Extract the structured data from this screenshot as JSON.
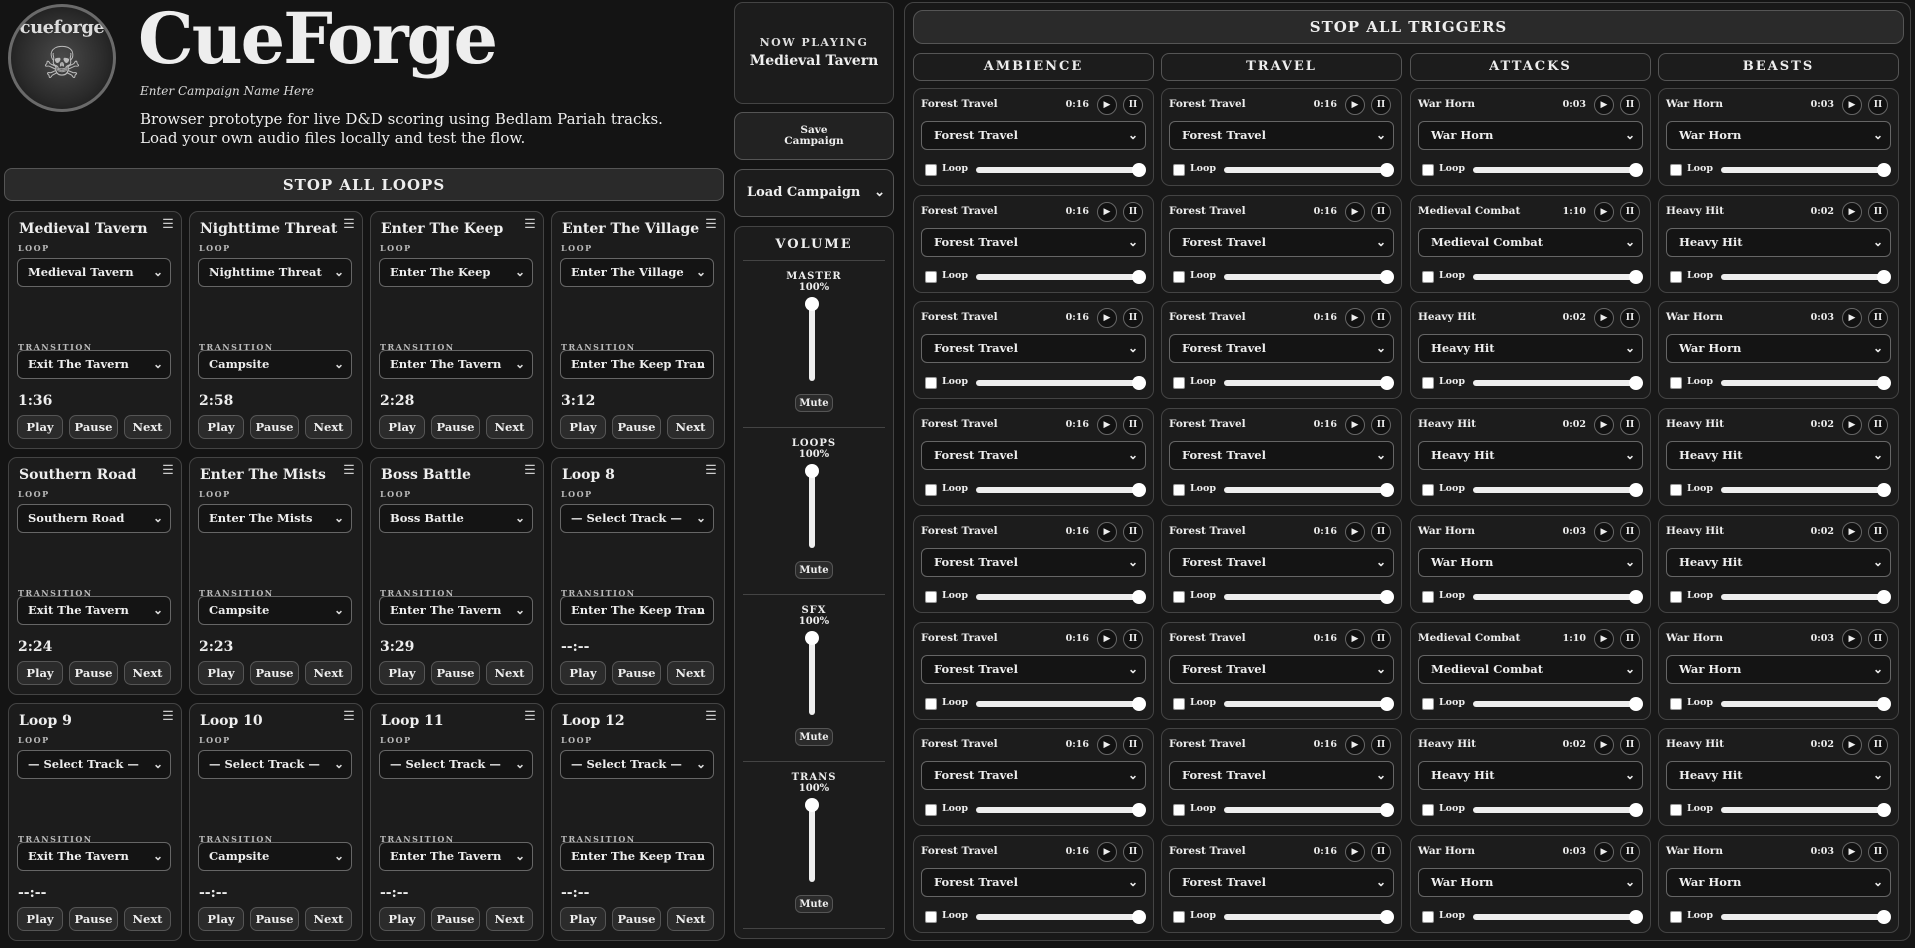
{
  "header": {
    "logo_text": "cueforge",
    "title": "CueForge",
    "campaign_name": "Enter Campaign Name Here",
    "subtitle": "Browser prototype for live D&D scoring using Bedlam Pariah tracks. Load your own audio files locally and test the flow."
  },
  "stop_all_loops": "STOP ALL LOOPS",
  "labels": {
    "loop": "LOOP",
    "transition": "TRANSITION",
    "play": "Play",
    "pause": "Pause",
    "next": "Next"
  },
  "loop_cards": [
    {
      "title": "Medieval Tavern",
      "loop": "Medieval Tavern",
      "transition": "Exit The Tavern",
      "time": "1:36"
    },
    {
      "title": "Nighttime Threat",
      "loop": "Nighttime Threat",
      "transition": "Campsite",
      "time": "2:58"
    },
    {
      "title": "Enter The Keep",
      "loop": "Enter The Keep",
      "transition": "Enter The Tavern",
      "time": "2:28"
    },
    {
      "title": "Enter The Village",
      "loop": "Enter The Village",
      "transition": "Enter The Keep Tran",
      "time": "3:12"
    },
    {
      "title": "Southern Road",
      "loop": "Southern Road",
      "transition": "Exit The Tavern",
      "time": "2:24"
    },
    {
      "title": "Enter The Mists",
      "loop": "Enter The Mists",
      "transition": "Campsite",
      "time": "2:23"
    },
    {
      "title": "Boss Battle",
      "loop": "Boss Battle",
      "transition": "Enter The Tavern",
      "time": "3:29"
    },
    {
      "title": "Loop 8",
      "loop": "— Select Track —",
      "transition": "Enter The Keep Tran",
      "time": "--:--"
    },
    {
      "title": "Loop 9",
      "loop": "— Select Track —",
      "transition": "Exit The Tavern",
      "time": "--:--"
    },
    {
      "title": "Loop 10",
      "loop": "— Select Track —",
      "transition": "Campsite",
      "time": "--:--"
    },
    {
      "title": "Loop 11",
      "loop": "— Select Track —",
      "transition": "Enter The Tavern",
      "time": "--:--"
    },
    {
      "title": "Loop 12",
      "loop": "— Select Track —",
      "transition": "Enter The Keep Tran",
      "time": "--:--"
    }
  ],
  "now_playing": {
    "label": "NOW PLAYING",
    "track": "Medieval Tavern"
  },
  "save_campaign": {
    "line1": "Save",
    "line2": "Campaign"
  },
  "load_campaign": "Load Campaign",
  "volume": {
    "title": "VOLUME",
    "mute_label": "Mute",
    "channels": [
      {
        "name": "MASTER",
        "percent": "100%",
        "level": 1.0
      },
      {
        "name": "LOOPS",
        "percent": "100%",
        "level": 1.0
      },
      {
        "name": "SFX",
        "percent": "100%",
        "level": 1.0
      },
      {
        "name": "TRANS",
        "percent": "100%",
        "level": 1.0
      }
    ]
  },
  "stop_all_triggers": "STOP ALL TRIGGERS",
  "trigger_loop_label": "Loop",
  "trigger_columns": [
    {
      "name": "AMBIENCE",
      "triggers": [
        {
          "name": "Forest Travel",
          "time": "0:16",
          "track": "Forest Travel",
          "volume": 1.0
        },
        {
          "name": "Forest Travel",
          "time": "0:16",
          "track": "Forest Travel",
          "volume": 1.0
        },
        {
          "name": "Forest Travel",
          "time": "0:16",
          "track": "Forest Travel",
          "volume": 1.0
        },
        {
          "name": "Forest Travel",
          "time": "0:16",
          "track": "Forest Travel",
          "volume": 1.0
        },
        {
          "name": "Forest Travel",
          "time": "0:16",
          "track": "Forest Travel",
          "volume": 1.0
        },
        {
          "name": "Forest Travel",
          "time": "0:16",
          "track": "Forest Travel",
          "volume": 1.0
        },
        {
          "name": "Forest Travel",
          "time": "0:16",
          "track": "Forest Travel",
          "volume": 1.0
        },
        {
          "name": "Forest Travel",
          "time": "0:16",
          "track": "Forest Travel",
          "volume": 1.0
        }
      ]
    },
    {
      "name": "TRAVEL",
      "triggers": [
        {
          "name": "Forest Travel",
          "time": "0:16",
          "track": "Forest Travel",
          "volume": 1.0
        },
        {
          "name": "Forest Travel",
          "time": "0:16",
          "track": "Forest Travel",
          "volume": 1.0
        },
        {
          "name": "Forest Travel",
          "time": "0:16",
          "track": "Forest Travel",
          "volume": 1.0
        },
        {
          "name": "Forest Travel",
          "time": "0:16",
          "track": "Forest Travel",
          "volume": 1.0
        },
        {
          "name": "Forest Travel",
          "time": "0:16",
          "track": "Forest Travel",
          "volume": 1.0
        },
        {
          "name": "Forest Travel",
          "time": "0:16",
          "track": "Forest Travel",
          "volume": 1.0
        },
        {
          "name": "Forest Travel",
          "time": "0:16",
          "track": "Forest Travel",
          "volume": 1.0
        },
        {
          "name": "Forest Travel",
          "time": "0:16",
          "track": "Forest Travel",
          "volume": 1.0
        }
      ]
    },
    {
      "name": "ATTACKS",
      "triggers": [
        {
          "name": "War Horn",
          "time": "0:03",
          "track": "War Horn",
          "volume": 1.0
        },
        {
          "name": "Medieval Combat",
          "time": "1:10",
          "track": "Medieval Combat",
          "volume": 1.0
        },
        {
          "name": "Heavy Hit",
          "time": "0:02",
          "track": "Heavy Hit",
          "volume": 1.0
        },
        {
          "name": "Heavy Hit",
          "time": "0:02",
          "track": "Heavy Hit",
          "volume": 1.0
        },
        {
          "name": "War Horn",
          "time": "0:03",
          "track": "War Horn",
          "volume": 1.0
        },
        {
          "name": "Medieval Combat",
          "time": "1:10",
          "track": "Medieval Combat",
          "volume": 1.0
        },
        {
          "name": "Heavy Hit",
          "time": "0:02",
          "track": "Heavy Hit",
          "volume": 1.0
        },
        {
          "name": "War Horn",
          "time": "0:03",
          "track": "War Horn",
          "volume": 1.0
        }
      ]
    },
    {
      "name": "BEASTS",
      "triggers": [
        {
          "name": "War Horn",
          "time": "0:03",
          "track": "War Horn",
          "volume": 1.0
        },
        {
          "name": "Heavy Hit",
          "time": "0:02",
          "track": "Heavy Hit",
          "volume": 1.0
        },
        {
          "name": "War Horn",
          "time": "0:03",
          "track": "War Horn",
          "volume": 1.0
        },
        {
          "name": "Heavy Hit",
          "time": "0:02",
          "track": "Heavy Hit",
          "volume": 1.0
        },
        {
          "name": "Heavy Hit",
          "time": "0:02",
          "track": "Heavy Hit",
          "volume": 1.0
        },
        {
          "name": "War Horn",
          "time": "0:03",
          "track": "War Horn",
          "volume": 1.0
        },
        {
          "name": "Heavy Hit",
          "time": "0:02",
          "track": "Heavy Hit",
          "volume": 1.0
        },
        {
          "name": "War Horn",
          "time": "0:03",
          "track": "War Horn",
          "volume": 1.0
        }
      ]
    }
  ],
  "icons": {
    "menu": "hamburger-icon",
    "play": "play-icon",
    "pause": "pause-icon",
    "chevron": "chevron-down-icon"
  },
  "colors": {
    "background": "#141414",
    "card": "#1c1c1c",
    "border": "#444444",
    "text": "#e8e8e8"
  }
}
